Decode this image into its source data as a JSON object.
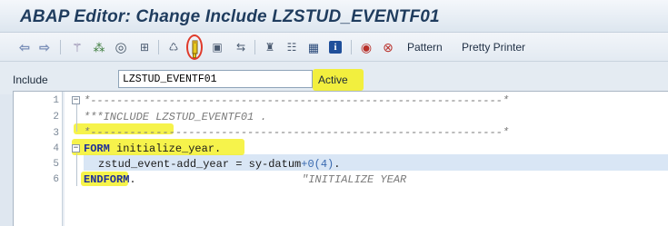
{
  "window": {
    "title": "ABAP Editor: Change Include LZSTUD_EVENTF01"
  },
  "toolbar": {
    "icons": [
      "back-arrow-icon",
      "forward-arrow-icon",
      "wand-icon",
      "object-list-icon",
      "spiral-icon",
      "where-used-icon",
      "edit-pencil-icon",
      "screen-icon",
      "network-icon",
      "tree-icon",
      "hierarchy-icon",
      "grid-icon",
      "info-icon",
      "breakpoint-icon",
      "delete-breakpoint-icon"
    ],
    "pattern_label": "Pattern",
    "pretty_printer_label": "Pretty Printer"
  },
  "include": {
    "label": "Include",
    "value": "LZSTUD_EVENTF01",
    "status": "Active"
  },
  "editor": {
    "lines": [
      {
        "number": "1",
        "text": "*---------------------------------------------------------------*"
      },
      {
        "number": "2",
        "text": "***INCLUDE LZSTUD_EVENTF01 ."
      },
      {
        "number": "3",
        "text": "*---------------------------------------------------------------*"
      },
      {
        "number": "4",
        "keyword": "FORM",
        "text": " initialize_year."
      },
      {
        "number": "5",
        "text_a": "zstud_event-add_year = sy-datum",
        "text_b": "+0(4)",
        "text_c": "."
      },
      {
        "number": "6",
        "keyword": "ENDFORM",
        "text": ".",
        "comment": "\"INITIALIZE YEAR"
      }
    ]
  },
  "colors": {
    "highlight": "#f4f01e",
    "annotation_circle": "#e03a2a",
    "title": "#1f3c5e",
    "keyword": "#1f2f9a"
  }
}
